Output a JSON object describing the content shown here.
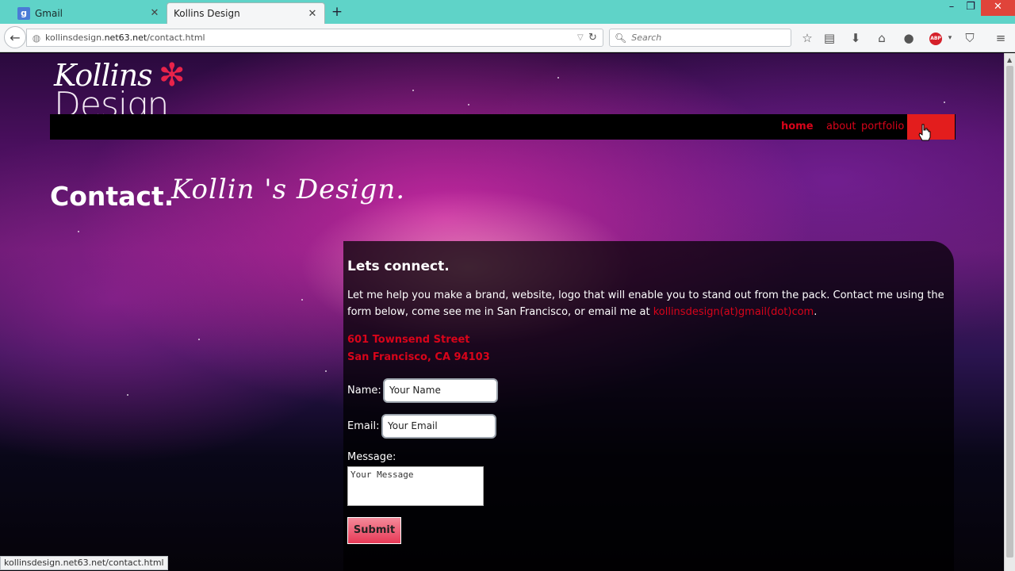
{
  "browser": {
    "tabs": [
      {
        "title": "Gmail",
        "favicon": "g-favicon-icon"
      },
      {
        "title": "Kollins Design",
        "favicon": "none"
      }
    ],
    "url_prefix": "kollinsdesign.",
    "url_domain": "net63.net",
    "url_path": "/contact.html",
    "search_placeholder": "Search",
    "status_url": "kollinsdesign.net63.net/contact.html",
    "colors": {
      "tabbar": "#5fd3c8",
      "close": "#e0443a"
    }
  },
  "site": {
    "logo_script": "Kollins",
    "logo_word": "Design",
    "nav": {
      "home": "home",
      "about": "about",
      "portfolio": "portfolio"
    },
    "headline": "Contact.",
    "headline_script": "Kollin 's Design.",
    "accent_color": "#d8041a"
  },
  "contact": {
    "heading": "Lets connect.",
    "intro_text": "Let me help you make a brand, website, logo that will enable you to stand out from the pack. Contact me using the form below, come see me in San Francisco, or email me at ",
    "email": "kollinsdesign(at)gmail(dot)com",
    "intro_end": ".",
    "address_line1": "601 Townsend Street",
    "address_line2": "San Francisco, CA 94103",
    "name_label": "Name:",
    "name_value": "Your Name",
    "email_label": "Email:",
    "email_value": "Your Email",
    "message_label": "Message:",
    "message_value": "Your Message",
    "submit_label": "Submit"
  }
}
